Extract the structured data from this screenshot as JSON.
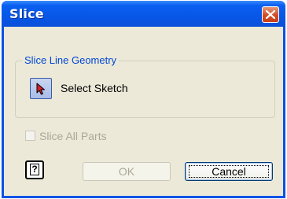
{
  "window": {
    "title": "Slice",
    "close_icon": "close-x-icon"
  },
  "slice_line_geometry": {
    "legend": "Slice Line Geometry",
    "select_icon": "cursor-arrow-icon",
    "select_label": "Select Sketch"
  },
  "slice_all_parts": {
    "label": "Slice All Parts",
    "checked": false,
    "enabled": false
  },
  "buttons": {
    "help_icon": "help-icon",
    "ok_label": "OK",
    "cancel_label": "Cancel"
  },
  "colors": {
    "titlebar": "#0757e8",
    "client_bg": "#ece9d8",
    "legend_text": "#0046d5",
    "close_button": "#d24b22",
    "disabled_text": "#aca899"
  }
}
